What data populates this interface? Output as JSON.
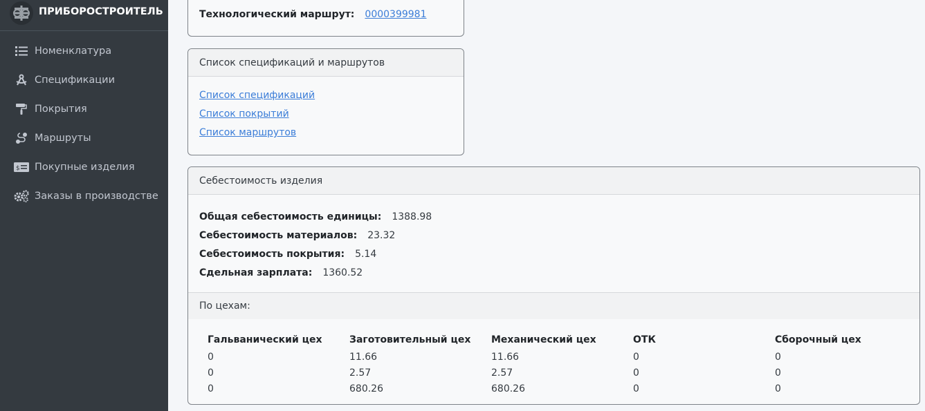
{
  "brand": {
    "name": "ПРИБОРОСТРОИТЕЛЬ",
    "logo_icon": "company-logo-icon"
  },
  "sidebar": {
    "items": [
      {
        "label": "Номенклатура",
        "icon": "list-icon"
      },
      {
        "label": "Спецификации",
        "icon": "drafting-compass-icon"
      },
      {
        "label": "Покрытия",
        "icon": "paint-roller-icon"
      },
      {
        "label": "Маршруты",
        "icon": "route-icon"
      },
      {
        "label": "Покупные изделия",
        "icon": "money-check-icon"
      },
      {
        "label": "Заказы в производстве",
        "icon": "gears-icon"
      }
    ]
  },
  "route_card": {
    "route_label": "Технологический маршрут:",
    "route_value": "0000399981"
  },
  "lists_card": {
    "title": "Список спецификаций и маршрутов",
    "links": [
      "Список спецификаций",
      "Список покрытий",
      "Список маршрутов"
    ]
  },
  "cost_card": {
    "title": "Себестоимость изделия",
    "rows": [
      {
        "label": "Общая себестоимость единицы:",
        "value": "1388.98"
      },
      {
        "label": "Себестоимость материалов:",
        "value": "23.32"
      },
      {
        "label": "Себестоимость покрытия:",
        "value": "5.14"
      },
      {
        "label": "Сдельная зарплата:",
        "value": "1360.52"
      }
    ],
    "by_workshop_label": "По цехам:",
    "workshop_table": {
      "headers": [
        "Гальванический цех",
        "Заготовительный цех",
        "Механический цех",
        "ОТК",
        "Сборочный цех"
      ],
      "rows": [
        [
          "0",
          "11.66",
          "11.66",
          "0",
          "0"
        ],
        [
          "0",
          "2.57",
          "2.57",
          "0",
          "0"
        ],
        [
          "0",
          "680.26",
          "680.26",
          "0",
          "0"
        ]
      ]
    }
  },
  "colors": {
    "sidebar_bg": "#343a40",
    "link": "#3b7dd8",
    "page_bg": "#f4f6f9"
  }
}
